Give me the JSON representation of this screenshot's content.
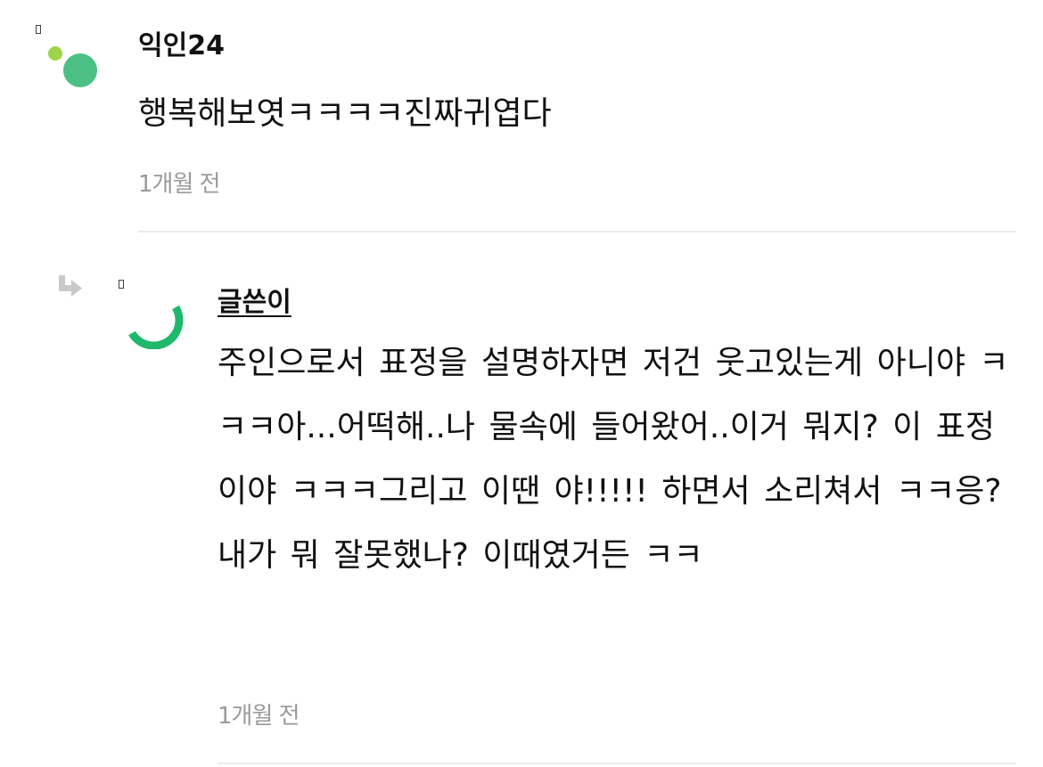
{
  "comments": [
    {
      "author": "익인24",
      "text": "행복해보엿ㅋㅋㅋㅋ진짜귀엽다",
      "time": "1개월 전",
      "avatar_colors": [
        "#9fd34b",
        "#4bbf84"
      ]
    },
    {
      "author": "글쓴이",
      "is_reply": true,
      "text": "주인으로서 표정을 설명하자면 저건 웃고있는게 아니야 ㅋㅋㅋ아...어떡해..나 물속에 들어왔어..이거 뭐지? 이 표정이야 ㅋㅋㅋ그리고 이땐 야!!!!! 하면서 소리쳐서 ㅋㅋ응? 내가 뭐 잘못했나? 이때였거든 ㅋㅋ",
      "time": "1개월 전",
      "avatar_color": "#1fb86c"
    }
  ],
  "icons": {
    "reply": "reply-arrow-icon",
    "marker": "image-marker-icon"
  },
  "colors": {
    "text": "#111111",
    "muted": "#9a9a9a",
    "divider": "#ececec"
  }
}
